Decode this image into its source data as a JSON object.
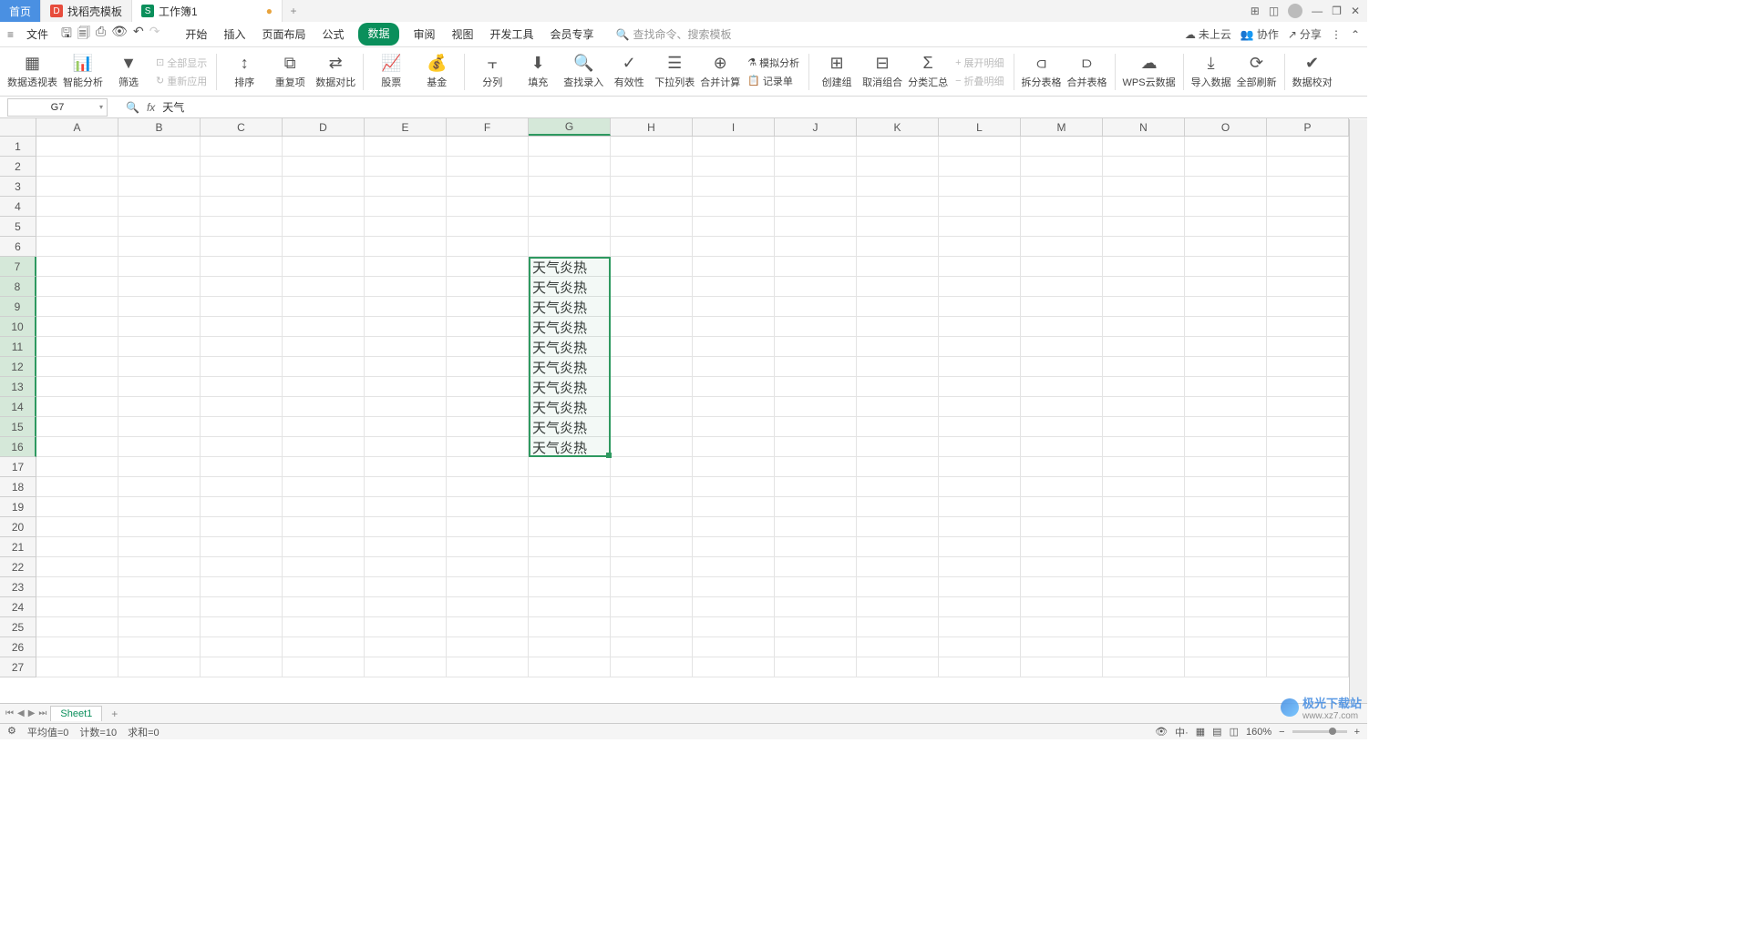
{
  "titlebar": {
    "home": "首页",
    "tpl": "找稻壳模板",
    "doc": "工作簿1"
  },
  "menu": {
    "file": "文件",
    "tabs": [
      "开始",
      "插入",
      "页面布局",
      "公式",
      "数据",
      "审阅",
      "视图",
      "开发工具",
      "会员专享"
    ],
    "active_index": 4,
    "search_ph": "查找命令、搜索模板"
  },
  "topright": {
    "cloud": "未上云",
    "coop": "协作",
    "share": "分享"
  },
  "ribbon": {
    "pivot": "数据透视表",
    "smart": "智能分析",
    "filter": "筛选",
    "showall": "全部显示",
    "reapply": "重新应用",
    "sort": "排序",
    "dup": "重复项",
    "compare": "数据对比",
    "stock": "股票",
    "fund": "基金",
    "split": "分列",
    "fill": "填充",
    "find": "查找录入",
    "valid": "有效性",
    "dropdown": "下拉列表",
    "consol": "合并计算",
    "record": "记录单",
    "simu": "模拟分析",
    "group": "创建组",
    "ungroup": "取消组合",
    "subtotal": "分类汇总",
    "expand": "展开明细",
    "collapse": "折叠明细",
    "splittbl": "拆分表格",
    "mergetbl": "合并表格",
    "wpscloud": "WPS云数据",
    "import": "导入数据",
    "refresh": "全部刷新",
    "check": "数据校对"
  },
  "formula": {
    "cellref": "G7",
    "content": "天气"
  },
  "columns": [
    "A",
    "B",
    "C",
    "D",
    "E",
    "F",
    "G",
    "H",
    "I",
    "J",
    "K",
    "L",
    "M",
    "N",
    "O",
    "P"
  ],
  "rows_count": 27,
  "sel": {
    "col": 6,
    "row_start": 7,
    "row_end": 16
  },
  "cell_value": "天气炎热",
  "sheet": {
    "name": "Sheet1"
  },
  "status": {
    "avg": "平均值=0",
    "count": "计数=10",
    "sum": "求和=0",
    "zoom": "160%",
    "ime": "中·"
  },
  "watermark": {
    "site": "极光下载站",
    "url": "www.xz7.com"
  }
}
